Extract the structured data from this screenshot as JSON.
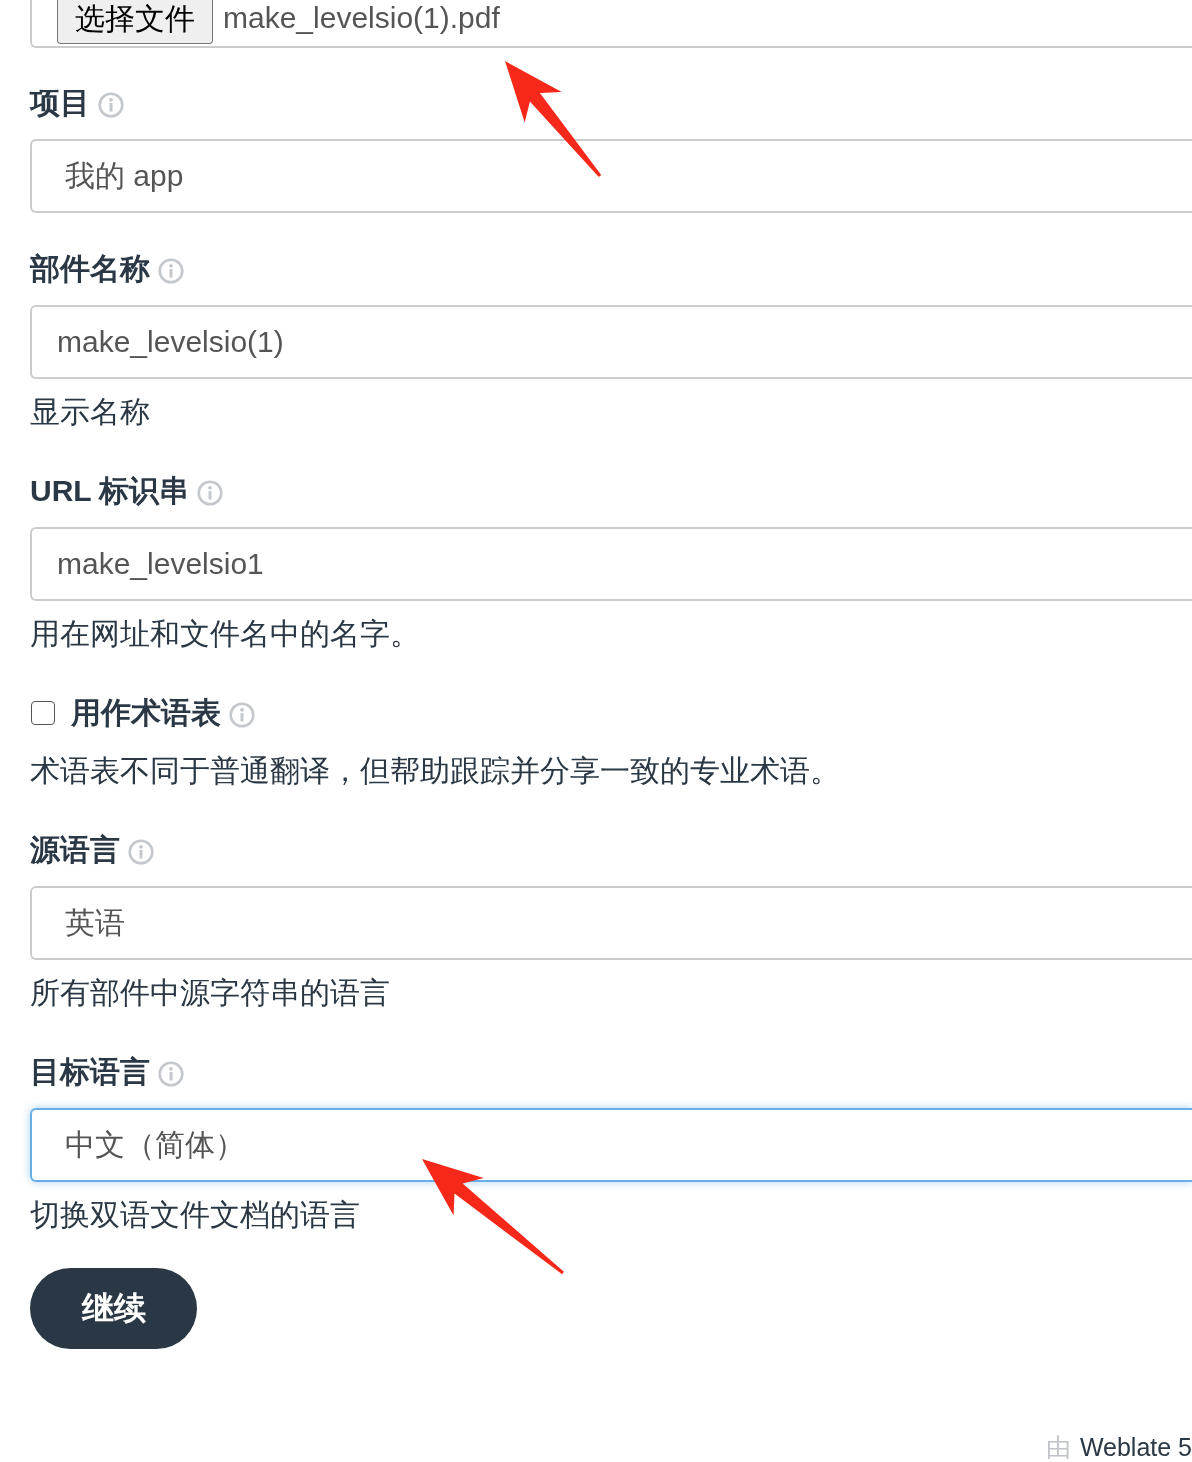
{
  "file_input": {
    "button": "选择文件",
    "filename": "make_levelsio(1).pdf"
  },
  "fields": [
    {
      "kind": "select",
      "label": "项目",
      "value": "我的 app",
      "focused": false
    },
    {
      "kind": "text",
      "label": "部件名称",
      "value": "make_levelsio(1)",
      "help": "显示名称",
      "focused": false
    },
    {
      "kind": "text",
      "label": "URL 标识串",
      "value": "make_levelsio1",
      "help": "用在网址和文件名中的名字。",
      "focused": false
    },
    {
      "kind": "checkbox",
      "label": "用作术语表",
      "checked": false,
      "help": "术语表不同于普通翻译，但帮助跟踪并分享一致的专业术语。"
    },
    {
      "kind": "select",
      "label": "源语言",
      "value": "英语",
      "help": "所有部件中源字符串的语言",
      "focused": false
    },
    {
      "kind": "select",
      "label": "目标语言",
      "value": "中文（简体）",
      "help": "切换双语文件文档的语言",
      "focused": true
    }
  ],
  "submit_button": "继续",
  "footer": {
    "prefix": "由",
    "link": "Weblate 5"
  }
}
